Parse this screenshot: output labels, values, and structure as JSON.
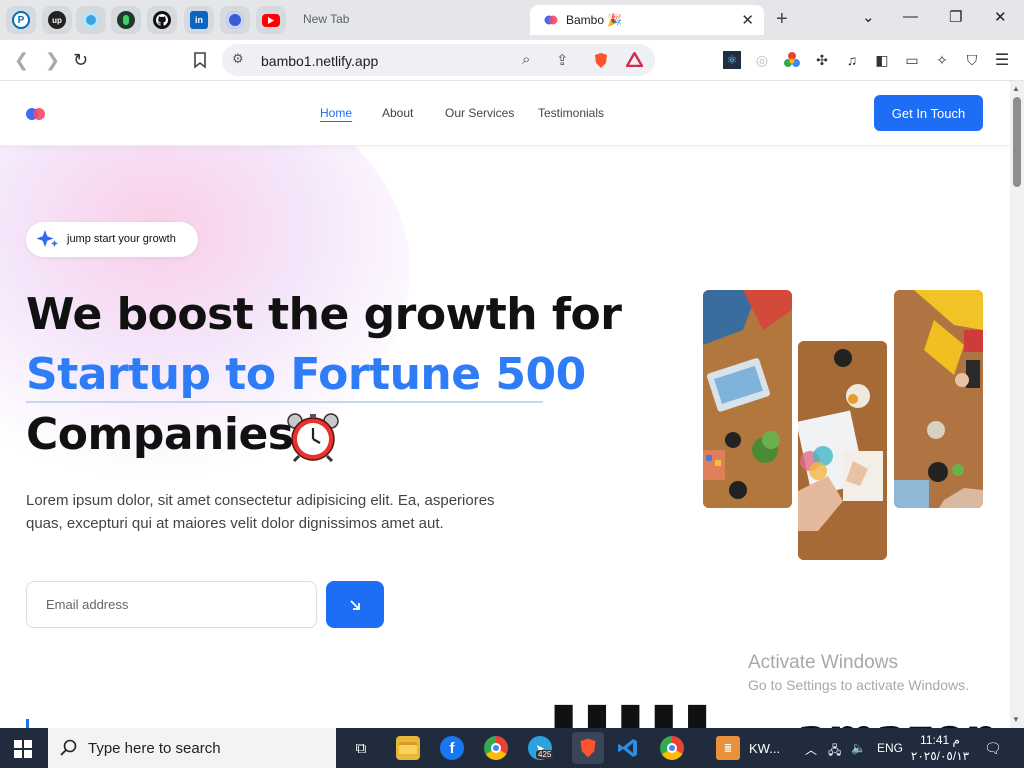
{
  "browser": {
    "pinned_tabs": [
      {
        "name": "paypal-tab",
        "icon": "paypal-icon",
        "letter": "P",
        "color": "#0070ba"
      },
      {
        "name": "upwork-tab",
        "icon": "upwork-icon",
        "letter": "up",
        "color": "#222222"
      },
      {
        "name": "tab-3",
        "icon": "circle-app-icon",
        "letter": "",
        "color": "#3aa3e3"
      },
      {
        "name": "tab-4",
        "icon": "green-app-icon",
        "letter": "",
        "color": "#1f3a2a"
      },
      {
        "name": "github-tab",
        "icon": "github-icon",
        "letter": "",
        "color": "#111111"
      },
      {
        "name": "linkedin-tab",
        "icon": "linkedin-icon",
        "letter": "in",
        "color": "#0a66c2"
      },
      {
        "name": "tab-7",
        "icon": "badge-app-icon",
        "letter": "",
        "color": "#3a5bd9"
      },
      {
        "name": "youtube-tab",
        "icon": "youtube-icon",
        "letter": "",
        "color": "#ff0000"
      }
    ],
    "new_tab_label": "New Tab",
    "active_tab_title": "Bambo 🎉",
    "url": "bambo1.netlify.app"
  },
  "site": {
    "nav": {
      "links": [
        "Home",
        "About",
        "Our Services",
        "Testimonials"
      ],
      "cta": "Get In Touch"
    },
    "hero": {
      "badge": "jump start your growth",
      "line1": "We boost the growth for",
      "line2": "Startup to Fortune 500",
      "line3": "Companies",
      "description": "Lorem ipsum dolor, sit amet consectetur adipisicing elit. Ea, asperiores quas, excepturi qui at maiores velit dolor dignissimos amet aut.",
      "email_placeholder": "Email address",
      "submit_icon": "arrow-down-right-icon"
    },
    "partner_logos_partial": [
      "amazon"
    ]
  },
  "watermark": {
    "title": "Activate Windows",
    "subtitle": "Go to Settings to activate Windows."
  },
  "taskbar": {
    "search_placeholder": "Type here to search",
    "telegram_badge": "425",
    "running_app_label": "KW...",
    "language": "ENG",
    "time": "11:41 م",
    "date": "٢٠٢٥/٠٥/١٣"
  },
  "colors": {
    "accent": "#1d6ef5",
    "headline_blue": "#2f7df6"
  }
}
